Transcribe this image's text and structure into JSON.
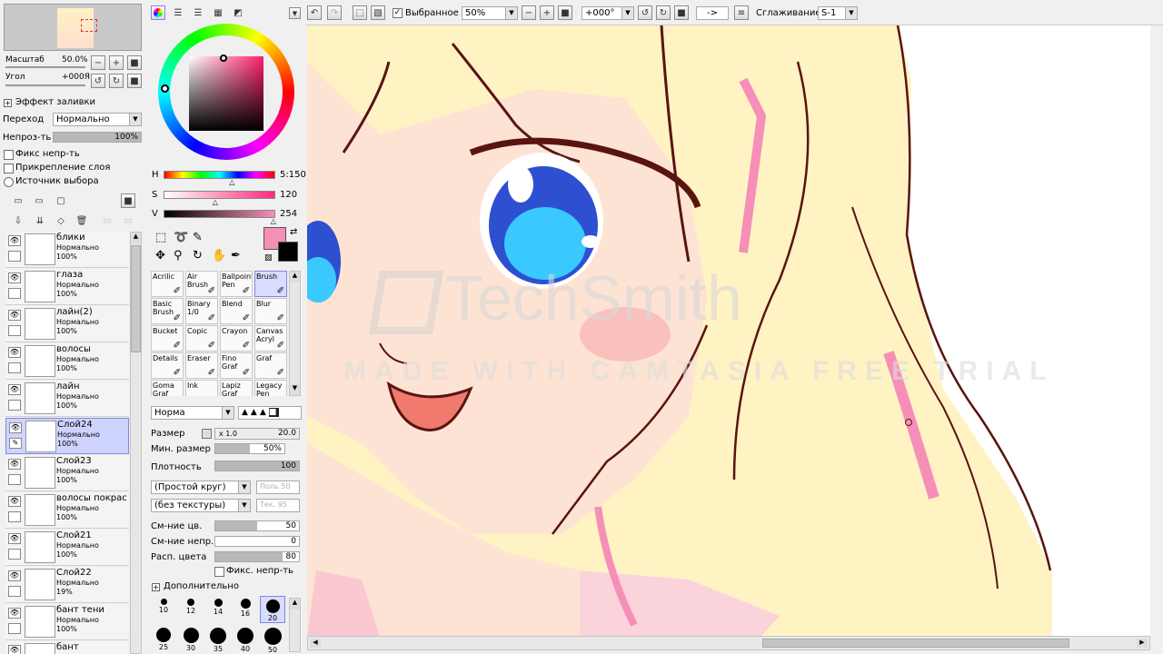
{
  "navigator": {
    "zoom_label": "Масштаб",
    "zoom_value": "50.0%",
    "angle_label": "Угол",
    "angle_value": "+000Я"
  },
  "fill_effect": {
    "title": "Эффект заливки",
    "transition_label": "Переход",
    "transition_value": "Нормально",
    "opacity_label": "Непроз-ть",
    "opacity_value": "100%",
    "opacity_fraction": 1.0,
    "chk_fix": "Фикс непр-ть",
    "chk_clip": "Прикрепление слоя",
    "chk_source": "Источник выбора"
  },
  "layers": [
    {
      "name": "блики",
      "mode": "Нормально",
      "opacity": "100%",
      "selected": false
    },
    {
      "name": "глаза",
      "mode": "Нормально",
      "opacity": "100%",
      "selected": false
    },
    {
      "name": "лайн(2)",
      "mode": "Нормально",
      "opacity": "100%",
      "selected": false
    },
    {
      "name": "волосы",
      "mode": "Нормально",
      "opacity": "100%",
      "selected": false
    },
    {
      "name": "лайн",
      "mode": "Нормально",
      "opacity": "100%",
      "selected": false
    },
    {
      "name": "Слой24",
      "mode": "Нормально",
      "opacity": "100%",
      "selected": true
    },
    {
      "name": "Слой23",
      "mode": "Нормально",
      "opacity": "100%",
      "selected": false
    },
    {
      "name": "волосы покрас",
      "mode": "Нормально",
      "opacity": "100%",
      "selected": false
    },
    {
      "name": "Слой21",
      "mode": "Нормально",
      "opacity": "100%",
      "selected": false
    },
    {
      "name": "Слой22",
      "mode": "Нормально",
      "opacity": "19%",
      "selected": false
    },
    {
      "name": "бант тени",
      "mode": "Нормально",
      "opacity": "100%",
      "selected": false
    },
    {
      "name": "бант",
      "mode": "",
      "opacity": "",
      "selected": false
    }
  ],
  "color": {
    "h_label": "H",
    "h_value": "5:150",
    "h_fraction": 0.62,
    "s_label": "S",
    "s_value": "120",
    "s_fraction": 0.47,
    "v_label": "V",
    "v_value": "254",
    "v_fraction": 0.99,
    "primary": "#f58fb8",
    "secondary": "#000000"
  },
  "tools": [
    {
      "line1": "Acrilic",
      "line2": "",
      "selected": false
    },
    {
      "line1": "Air",
      "line2": "Brush",
      "selected": false
    },
    {
      "line1": "Ballpoint",
      "line2": "Pen",
      "selected": false
    },
    {
      "line1": "Brush",
      "line2": "",
      "selected": true
    },
    {
      "line1": "Basic",
      "line2": "Brush",
      "selected": false
    },
    {
      "line1": "Binary",
      "line2": "1/0",
      "selected": false
    },
    {
      "line1": "Blend",
      "line2": "",
      "selected": false
    },
    {
      "line1": "Blur",
      "line2": "",
      "selected": false
    },
    {
      "line1": "Bucket",
      "line2": "",
      "selected": false
    },
    {
      "line1": "Copic",
      "line2": "",
      "selected": false
    },
    {
      "line1": "Crayon",
      "line2": "",
      "selected": false
    },
    {
      "line1": "Canvas",
      "line2": "Acryl",
      "selected": false
    },
    {
      "line1": "Details",
      "line2": "",
      "selected": false
    },
    {
      "line1": "Eraser",
      "line2": "",
      "selected": false
    },
    {
      "line1": "Fino",
      "line2": "Graf",
      "selected": false
    },
    {
      "line1": "Graf",
      "line2": "",
      "selected": false
    },
    {
      "line1": "Goma",
      "line2": "Graf",
      "selected": false
    },
    {
      "line1": "Ink",
      "line2": "",
      "selected": false
    },
    {
      "line1": "Lapiz",
      "line2": "Graf",
      "selected": false
    },
    {
      "line1": "Legacy",
      "line2": "Pen",
      "selected": false
    }
  ],
  "brush": {
    "blend_mode": "Норма",
    "size_label": "Размер",
    "size_mult": "x 1.0",
    "size_value": "20.0",
    "min_size_label": "Мин. размер",
    "min_size_value": "50%",
    "min_size_fraction": 0.5,
    "density_label": "Плотность",
    "density_value": "100",
    "density_fraction": 1.0,
    "shape": "(Простой круг)",
    "shape_strength": "Поль 50",
    "texture": "(без текстуры)",
    "texture_strength": "Тек. 95",
    "mix_color_label": "См-ние цв.",
    "mix_color_value": "50",
    "mix_color_fraction": 0.5,
    "mix_opacity_label": "См-ние непр.",
    "mix_opacity_value": "0",
    "mix_opacity_fraction": 0.0,
    "spread_label": "Расп. цвета",
    "spread_value": "80",
    "spread_fraction": 0.8,
    "fix_opacity": "Фикс. непр-ть",
    "advanced": "Дополнительно"
  },
  "brush_sizes": [
    {
      "label": "10",
      "d": 7
    },
    {
      "label": "12",
      "d": 8
    },
    {
      "label": "14",
      "d": 9
    },
    {
      "label": "16",
      "d": 11
    },
    {
      "label": "20",
      "d": 15
    },
    {
      "label": "25",
      "d": 16
    },
    {
      "label": "30",
      "d": 17
    },
    {
      "label": "35",
      "d": 18
    },
    {
      "label": "40",
      "d": 18
    },
    {
      "label": "50",
      "d": 19
    }
  ],
  "toolbar": {
    "selection_chk": "Выбранное",
    "zoom": "50%",
    "rotation": "+000°",
    "flip": "->",
    "smoothing_label": "Сглаживание",
    "smoothing_value": "S-1"
  },
  "watermark": {
    "brand": "TechSmith",
    "line": "MADE WITH CAMTASIA FREE TRIAL"
  }
}
